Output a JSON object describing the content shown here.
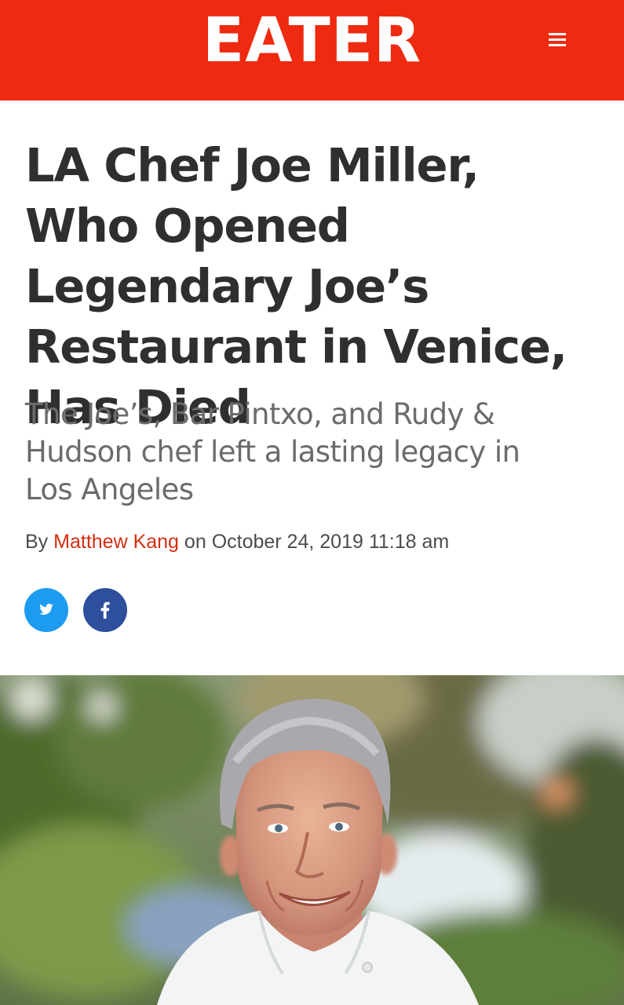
{
  "site": {
    "logo": "EATER",
    "brand_color": "#ee2a10",
    "menu_icon": "hamburger-menu-icon"
  },
  "article": {
    "headline": "LA Chef Joe Miller, Who Opened Legendary Joe’s Restaurant in Venice, Has Died",
    "dek": "The Joe’s, Bar Pintxo, and Rudy & Hudson chef left a lasting legacy in Los Angeles",
    "byline": {
      "by": "By",
      "author": "Matthew Kang",
      "on": "on",
      "date": "October 24, 2019 11:18 am"
    }
  },
  "share": {
    "twitter_icon": "twitter-icon",
    "twitter_color": "#1d9bf0",
    "facebook_icon": "facebook-icon",
    "facebook_color": "#2d4f9c"
  },
  "hero_image": {
    "subject": "chef-portrait-photo"
  }
}
